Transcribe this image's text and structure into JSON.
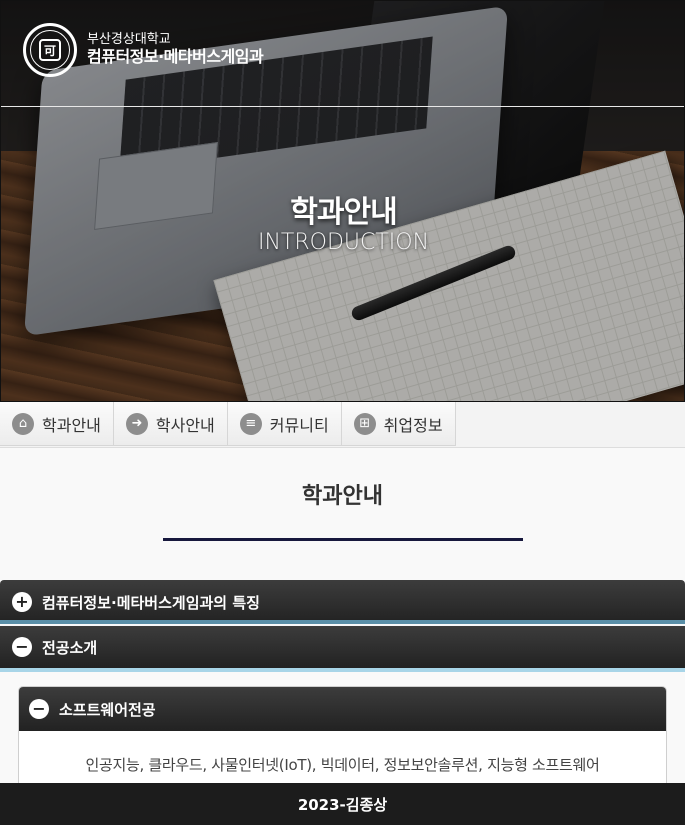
{
  "header": {
    "university": "부산경상대학교",
    "department": "컴퓨터정보·메타버스게임과",
    "hero_title": "학과안내",
    "hero_subtitle": "INTRODUCTION"
  },
  "nav": {
    "items": [
      {
        "label": "학과안내",
        "icon": "home-icon"
      },
      {
        "label": "학사안내",
        "icon": "arrow-right-icon"
      },
      {
        "label": "커뮤니티",
        "icon": "menu-icon"
      },
      {
        "label": "취업정보",
        "icon": "grid-icon"
      }
    ]
  },
  "main": {
    "page_title": "학과안내",
    "accordion": [
      {
        "title": "컴퓨터정보·메타버스게임과의 특징",
        "state": "collapsed",
        "icon": "plus-icon"
      },
      {
        "title": "전공소개",
        "state": "expanded",
        "icon": "minus-icon"
      }
    ],
    "sub_panel": {
      "title": "소프트웨어전공",
      "icon": "minus-icon",
      "body": "인공지능, 클라우드, 사물인터넷(IoT), 빅데이터, 정보보안솔루션, 지능형 소프트웨어"
    }
  },
  "footer": {
    "text": "2023-김종상"
  },
  "colors": {
    "accent_rule": "#17183d",
    "accordion_dark": "#2b2b2b",
    "accordion_highlight": "#a8d5e8"
  }
}
